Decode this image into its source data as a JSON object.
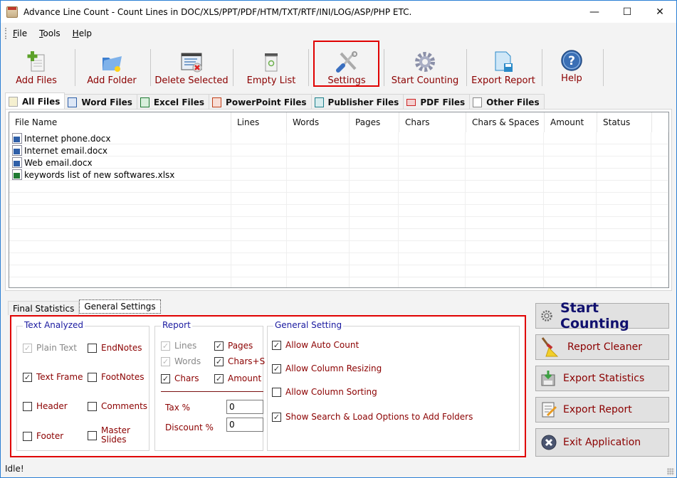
{
  "window": {
    "title": "Advance Line Count - Count Lines in DOC/XLS/PPT/PDF/HTM/TXT/RTF/INI/LOG/ASP/PHP ETC.",
    "controls": {
      "minimize": "—",
      "maximize": "☐",
      "close": "✕"
    }
  },
  "menu": [
    {
      "label": "File",
      "accel": "F"
    },
    {
      "label": "Tools",
      "accel": "T"
    },
    {
      "label": "Help",
      "accel": "H"
    }
  ],
  "toolbar": [
    {
      "label": "Add Files",
      "icon": "add-file-icon"
    },
    {
      "label": "Add Folder",
      "icon": "add-folder-icon"
    },
    {
      "label": "Delete Selected",
      "icon": "delete-selected-icon"
    },
    {
      "label": "Empty List",
      "icon": "recycle-bin-icon"
    },
    {
      "label": "Settings",
      "icon": "tools-icon",
      "highlighted": true
    },
    {
      "label": "Start Counting",
      "icon": "gear-icon"
    },
    {
      "label": "Export Report",
      "icon": "export-save-icon"
    },
    {
      "label": "Help",
      "icon": "help-icon"
    }
  ],
  "file_tabs": [
    {
      "label": "All Files",
      "active": true
    },
    {
      "label": "Word Files"
    },
    {
      "label": "Excel Files"
    },
    {
      "label": "PowerPoint Files"
    },
    {
      "label": "Publisher Files"
    },
    {
      "label": "PDF Files"
    },
    {
      "label": "Other Files"
    }
  ],
  "table": {
    "columns": [
      "File Name",
      "Lines",
      "Words",
      "Pages",
      "Chars",
      "Chars & Spaces",
      "Amount",
      "Status"
    ],
    "rows": [
      {
        "name": "Internet phone.docx",
        "type": "word",
        "lines": "",
        "words": "",
        "pages": "",
        "chars": "",
        "chars_spaces": "",
        "amount": "",
        "status": ""
      },
      {
        "name": "Internet email.docx",
        "type": "word",
        "lines": "",
        "words": "",
        "pages": "",
        "chars": "",
        "chars_spaces": "",
        "amount": "",
        "status": ""
      },
      {
        "name": "Web email.docx",
        "type": "word",
        "lines": "",
        "words": "",
        "pages": "",
        "chars": "",
        "chars_spaces": "",
        "amount": "",
        "status": ""
      },
      {
        "name": "keywords list of new softwares.xlsx",
        "type": "excel",
        "lines": "",
        "words": "",
        "pages": "",
        "chars": "",
        "chars_spaces": "",
        "amount": "",
        "status": ""
      }
    ]
  },
  "bottom_tabs": [
    {
      "label": "Final Statistics"
    },
    {
      "label": "General Settings",
      "active": true
    }
  ],
  "text_analyzed": {
    "title": "Text Analyzed",
    "options": [
      {
        "label": "Plain Text",
        "checked": true,
        "disabled": true
      },
      {
        "label": "EndNotes",
        "checked": false
      },
      {
        "label": "Text Frame",
        "checked": true
      },
      {
        "label": "FootNotes",
        "checked": false
      },
      {
        "label": "Header",
        "checked": false
      },
      {
        "label": "Comments",
        "checked": false
      },
      {
        "label": "Footer",
        "checked": false
      },
      {
        "label": "Master Slides",
        "checked": false
      }
    ]
  },
  "report": {
    "title": "Report",
    "options": [
      {
        "label": "Lines",
        "checked": true,
        "disabled": true
      },
      {
        "label": "Pages",
        "checked": true
      },
      {
        "label": "Words",
        "checked": true,
        "disabled": true
      },
      {
        "label": "Chars+S",
        "checked": true
      },
      {
        "label": "Chars",
        "checked": true
      },
      {
        "label": "Amount",
        "checked": true
      }
    ],
    "tax_label": "Tax %",
    "tax_value": "0",
    "discount_label": "Discount %",
    "discount_value": "0"
  },
  "general_setting": {
    "title": "General Setting",
    "options": [
      {
        "label": "Allow Auto Count",
        "checked": true
      },
      {
        "label": "Allow Column Resizing",
        "checked": true
      },
      {
        "label": "Allow Column Sorting",
        "checked": false
      },
      {
        "label": "Show Search & Load Options to Add Folders",
        "checked": true
      }
    ]
  },
  "side_buttons": [
    {
      "label": "Start Counting",
      "icon": "gear-icon"
    },
    {
      "label": "Report Cleaner",
      "icon": "broom-icon"
    },
    {
      "label": "Export Statistics",
      "icon": "export-statistics-icon"
    },
    {
      "label": "Export Report",
      "icon": "edit-report-icon"
    },
    {
      "label": "Exit Application",
      "icon": "exit-icon"
    }
  ],
  "status": "Idle!",
  "colors": {
    "accent_red": "#e00000",
    "label_maroon": "#8b0000",
    "group_title_blue": "#1a1aa0",
    "primary_button_text": "#10106e",
    "window_border": "#2b7fd4"
  }
}
